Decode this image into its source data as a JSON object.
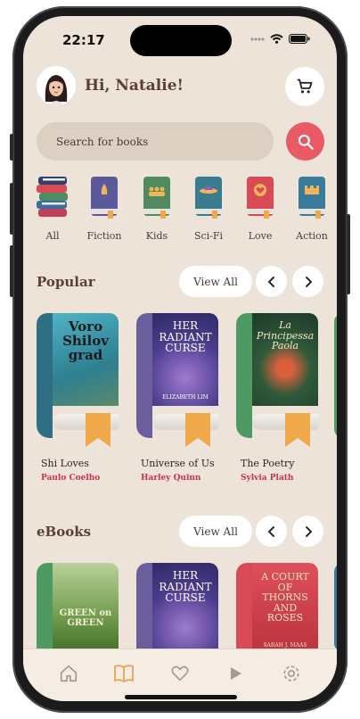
{
  "status_bar": {
    "time": "22:17"
  },
  "header": {
    "greeting": "Hi, Natalie!"
  },
  "search": {
    "placeholder": "Search for books"
  },
  "categories": [
    {
      "label": "All",
      "color": "#3a6fa0"
    },
    {
      "label": "Fiction",
      "color": "#5a5a9a"
    },
    {
      "label": "Kids",
      "color": "#4f8a60"
    },
    {
      "label": "Sci-Fi",
      "color": "#3a7b8f"
    },
    {
      "label": "Love",
      "color": "#d94a55"
    },
    {
      "label": "Action",
      "color": "#3a7b9a"
    }
  ],
  "popular": {
    "title": "Popular",
    "view_all": "View All",
    "books": [
      {
        "title": "Shi Loves",
        "author": "Paulo Coelho",
        "cover_text": "Voro Shilov grad",
        "spine_color": "#2f6f84"
      },
      {
        "title": "Universe of Us",
        "author": "Harley Quinn",
        "cover_text": "HER RADIANT CURSE",
        "cover_subtext": "ELIZABETH LIM",
        "spine_color": "#6a5e9c"
      },
      {
        "title": "The Poetry",
        "author": "Sylvia Plath",
        "cover_text": "La Principessa Paola",
        "spine_color": "#4f9a62"
      }
    ]
  },
  "ebooks": {
    "title": "eBooks",
    "view_all": "View All",
    "books": [
      {
        "cover_text": "GREEN on GREEN",
        "spine_color": "#4f9a62"
      },
      {
        "cover_text": "HER RADIANT CURSE",
        "spine_color": "#6a5e9c"
      },
      {
        "cover_text": "A COURT OF THORNS AND ROSES",
        "cover_subtext": "SARAH J. MAAS",
        "spine_color": "#d94a55"
      }
    ]
  },
  "colors": {
    "accent": "#e95a64",
    "background": "#ede3d8",
    "title": "#5a3f36",
    "author": "#d0314a"
  },
  "tabbar": {
    "items": [
      {
        "icon": "home-icon",
        "active": false
      },
      {
        "icon": "book-open-icon",
        "active": true
      },
      {
        "icon": "heart-icon",
        "active": false
      },
      {
        "icon": "play-icon",
        "active": false
      },
      {
        "icon": "settings-icon",
        "active": false
      }
    ]
  }
}
